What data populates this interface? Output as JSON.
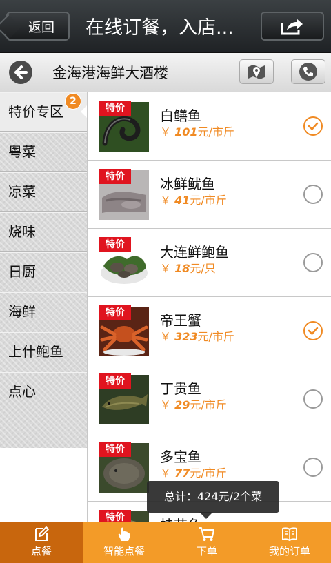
{
  "topbar": {
    "back_label": "返回",
    "title": "在线订餐，入店..."
  },
  "restaurant": {
    "name": "金海港海鲜大酒楼"
  },
  "categories": [
    {
      "label": "特价专区",
      "badge": "2"
    },
    {
      "label": "粤菜"
    },
    {
      "label": "凉菜"
    },
    {
      "label": "烧味"
    },
    {
      "label": "日厨"
    },
    {
      "label": "海鲜"
    },
    {
      "label": "上什鲍鱼"
    },
    {
      "label": "点心"
    }
  ],
  "dishes": [
    {
      "tag": "特价",
      "name": "白鳝鱼",
      "currency": "￥",
      "price": "101",
      "unit": "元/市斤",
      "selected": true
    },
    {
      "tag": "特价",
      "name": "冰鲜鱿鱼",
      "currency": "￥",
      "price": "41",
      "unit": "元/市斤",
      "selected": false
    },
    {
      "tag": "特价",
      "name": "大连鲜鲍鱼",
      "currency": "￥",
      "price": "18",
      "unit": "元/只",
      "selected": false
    },
    {
      "tag": "特价",
      "name": "帝王蟹",
      "currency": "￥",
      "price": "323",
      "unit": "元/市斤",
      "selected": true
    },
    {
      "tag": "特价",
      "name": "丁贵鱼",
      "currency": "￥",
      "price": "29",
      "unit": "元/市斤",
      "selected": false
    },
    {
      "tag": "特价",
      "name": "多宝鱼",
      "currency": "￥",
      "price": "77",
      "unit": "元/市斤",
      "selected": false
    },
    {
      "tag": "特价",
      "name": "桂花鱼"
    }
  ],
  "total": {
    "text": "总计：424元/2个菜"
  },
  "tabs": [
    {
      "label": "点餐",
      "icon": "pencil-icon"
    },
    {
      "label": "智能点餐",
      "icon": "hand-tap-icon"
    },
    {
      "label": "下单",
      "icon": "cart-icon"
    },
    {
      "label": "我的订单",
      "icon": "book-icon"
    }
  ],
  "colors": {
    "accent": "#f08a23",
    "tag_red": "#e0141f",
    "tabbar": "#f39b28",
    "tab_active": "#c8660d"
  }
}
